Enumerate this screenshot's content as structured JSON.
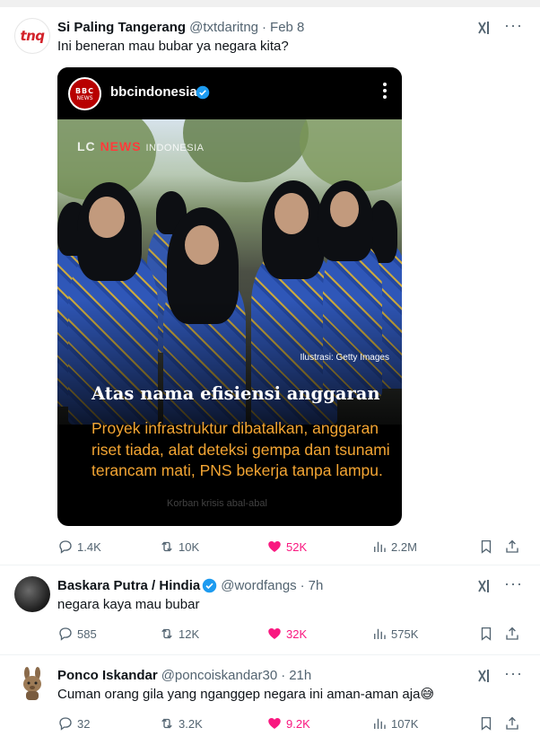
{
  "tweets": [
    {
      "avatar_text": "tnq",
      "name": "Si Paling Tangerang",
      "handle": "@txtdaritng",
      "time": "Feb 8",
      "text": "Ini beneran mau bubar ya negara kita?",
      "media": {
        "account": "bbcindonesia",
        "logo_top": "BBC",
        "logo_bottom": "NEWS",
        "watermark_left": "LC",
        "watermark_mid": "NEWS",
        "watermark_right": "INDONESIA",
        "photo_credit": "Ilustrasi: Getty Images",
        "headline": "Atas nama efisiensi anggaran",
        "subtext": "Proyek infrastruktur dibatalkan, anggaran riset tiada, alat deteksi gempa dan tsunami terancam mati, PNS bekerja tanpa lampu.",
        "faint_caption": "Korban krisis abal-abal"
      },
      "stats": {
        "replies": "1.4K",
        "reposts": "10K",
        "likes": "52K",
        "views": "2.2M"
      }
    },
    {
      "name": "Baskara Putra / Hindia",
      "handle": "@wordfangs",
      "time": "7h",
      "text": "negara kaya mau bubar",
      "stats": {
        "replies": "585",
        "reposts": "12K",
        "likes": "32K",
        "views": "575K"
      }
    },
    {
      "name": "Ponco Iskandar",
      "handle": "@poncoiskandar30",
      "time": "21h",
      "text": "Cuman orang gila yang nganggep negara ini aman-aman aja😅",
      "stats": {
        "replies": "32",
        "reposts": "3.2K",
        "likes": "9.2K",
        "views": "107K"
      }
    }
  ],
  "colors": {
    "like_active": "#f91880",
    "muted": "#536471",
    "verified": "#1d9bf0",
    "headline_orange": "#f3a533"
  },
  "icons": [
    "grok-icon",
    "more-icon",
    "reply-icon",
    "repost-icon",
    "like-icon",
    "views-icon",
    "bookmark-icon",
    "share-icon",
    "verified-icon"
  ]
}
